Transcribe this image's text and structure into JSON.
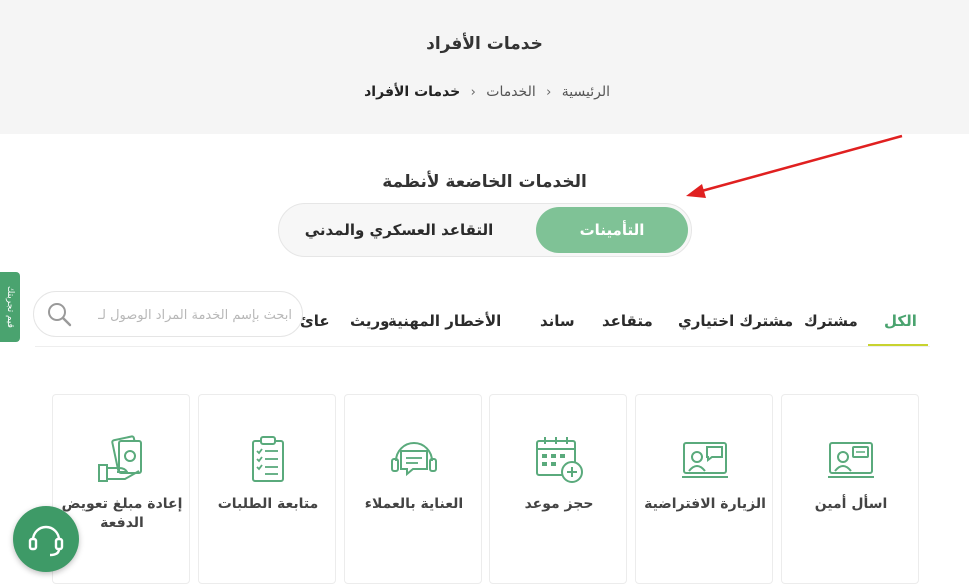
{
  "header": {
    "title": "خدمات الأفراد",
    "breadcrumb": [
      "الرئيسية",
      "الخدمات",
      "خدمات الأفراد"
    ]
  },
  "section": {
    "title": "الخدمات الخاضعة لأنظمة",
    "toggle": {
      "active": "التأمينات",
      "inactive": "التقاعد العسكري والمدني"
    }
  },
  "side_tab": {
    "label": "قيم تجربتك"
  },
  "search": {
    "placeholder": "ابحث بإسم الخدمة المراد الوصول لـ"
  },
  "tabs": [
    "الكل",
    "مشترك",
    "مشترك اختياري",
    "متقاعد",
    "ساند",
    "الأخطار المهنية",
    "وريث",
    "عائ"
  ],
  "cards": [
    {
      "label": "اسأل أمين",
      "icon": "agent-screen-icon"
    },
    {
      "label": "الزيارة الافتراضية",
      "icon": "virtual-visit-icon"
    },
    {
      "label": "حجز موعد",
      "icon": "calendar-add-icon"
    },
    {
      "label": "العناية بالعملاء",
      "icon": "headset-chat-icon"
    },
    {
      "label": "متابعة الطلبات",
      "icon": "clipboard-checklist-icon"
    },
    {
      "label": "إعادة مبلغ تعويض الدفعة",
      "icon": "cash-hand-icon"
    }
  ],
  "colors": {
    "accent": "#7fc296",
    "brand_green": "#4aa36f",
    "underline": "#c8d32f",
    "icon_stroke": "#5aaa7c"
  }
}
